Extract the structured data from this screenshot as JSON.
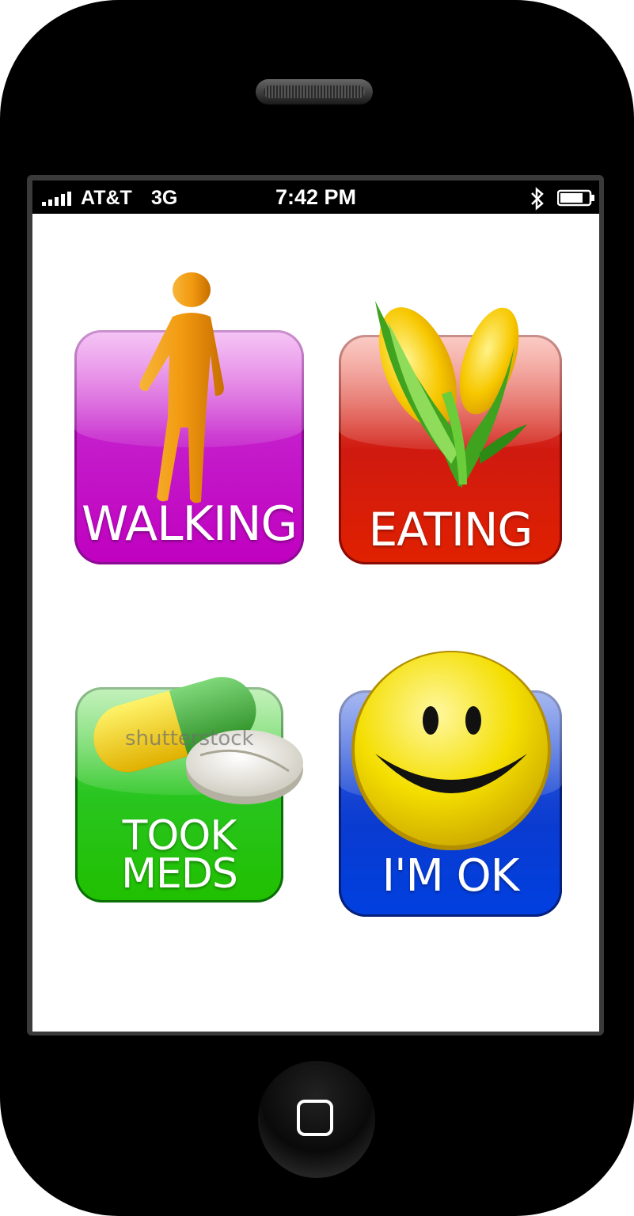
{
  "status_bar": {
    "carrier": "AT&T",
    "network": "3G",
    "time": "7:42 PM"
  },
  "tiles": [
    {
      "label": "WALKING",
      "color": "#c000c0",
      "icon": "walking-person-icon"
    },
    {
      "label": "EATING",
      "color": "#e02000",
      "icon": "corn-icon"
    },
    {
      "label_lines": [
        "TOOK",
        "MEDS"
      ],
      "color": "#20c000",
      "icon": "pills-icon"
    },
    {
      "label": "I'M OK",
      "color": "#0040e0",
      "icon": "smiley-face-icon"
    }
  ],
  "watermark": "shutterstock"
}
